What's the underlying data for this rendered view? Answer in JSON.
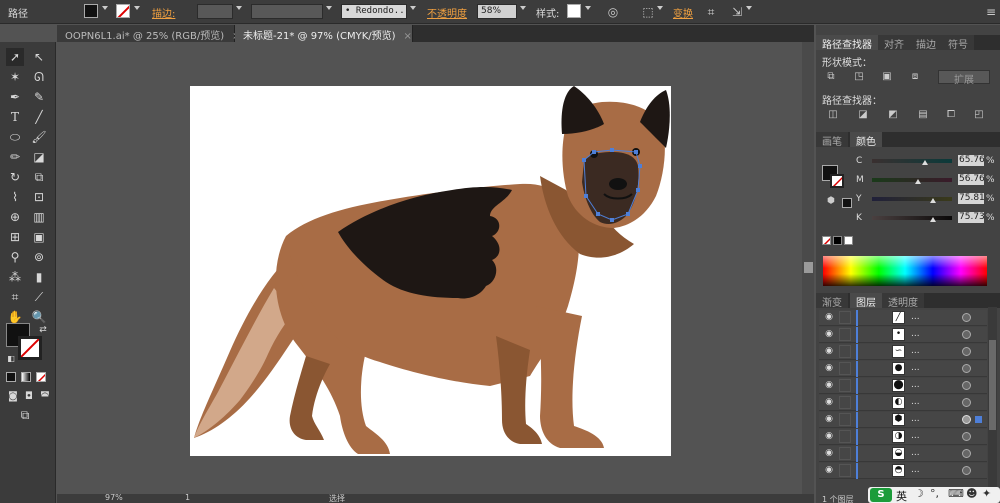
{
  "control_bar": {
    "mode_label": "路径",
    "stroke_label": "描边",
    "stroke_dash": ":",
    "brush_name": "Redondo...",
    "opacity_label": "不透明度",
    "opacity_value": "58%",
    "style_label": "样式",
    "style_colon": ":",
    "transform_label": "变换"
  },
  "doc_tabs": [
    {
      "label": "OOPN6L1.ai* @ 25% (RGB/预览)"
    },
    {
      "label": "未标题-21* @ 97% (CMYK/预览)"
    }
  ],
  "tab_close_glyph": "×",
  "status_bar": {
    "zoom": "97%",
    "page": "1",
    "tool": "选择"
  },
  "pathfinder_panel": {
    "tabs": [
      "路径查找器",
      "对齐",
      "描边",
      "符号"
    ],
    "shape_modes_label": "形状模式：",
    "expand_label": "扩展",
    "pathfinders_label": "路径查找器："
  },
  "color_panel": {
    "tabs": [
      "画笔",
      "颜色"
    ],
    "channels": [
      {
        "label": "C",
        "value": "65.76",
        "fraction": 0.66
      },
      {
        "label": "M",
        "value": "56.76",
        "fraction": 0.57
      },
      {
        "label": "Y",
        "value": "75.81",
        "fraction": 0.76
      },
      {
        "label": "K",
        "value": "75.73",
        "fraction": 0.76
      }
    ],
    "percent": "%"
  },
  "layers_panel": {
    "tabs": [
      "渐变",
      "图层",
      "透明度"
    ],
    "rows": [
      {
        "name": "..."
      },
      {
        "name": "..."
      },
      {
        "name": "..."
      },
      {
        "name": "..."
      },
      {
        "name": "..."
      },
      {
        "name": "..."
      },
      {
        "name": "..."
      },
      {
        "name": "..."
      },
      {
        "name": "..."
      },
      {
        "name": "..."
      }
    ],
    "footer": "1 个图层"
  },
  "taskbar": {
    "ime_lang": "英"
  },
  "colors": {
    "fur": "#a86c45",
    "fur_dark": "#8a5632",
    "saddle": "#1e1714",
    "tail_light": "#d2a88a",
    "face_mask": "#3b2a22",
    "accent_orange": "#f0a040",
    "selection": "#4e7fd8"
  }
}
